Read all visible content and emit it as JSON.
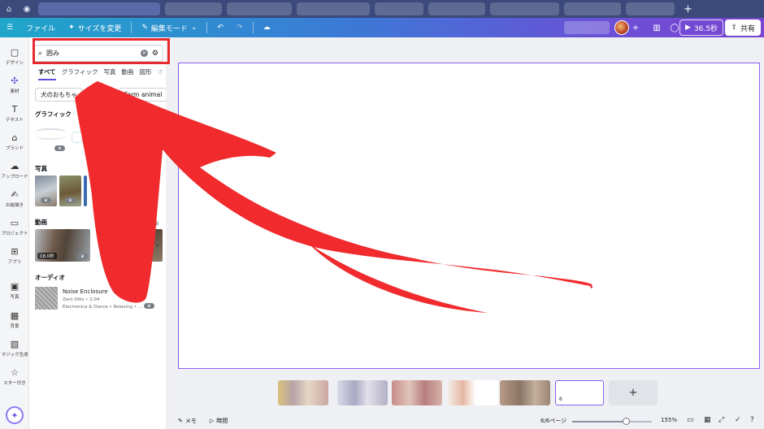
{
  "toolbar": {
    "file_label": "ファイル",
    "resize_label": "サイズを変更",
    "edit_mode_label": "編集モード",
    "play_label": "36.5秒",
    "share_label": "共有"
  },
  "rail": {
    "items": [
      {
        "label": "デザイン",
        "icon": "design-icon"
      },
      {
        "label": "素材",
        "icon": "elements-icon"
      },
      {
        "label": "テキスト",
        "icon": "text-icon"
      },
      {
        "label": "ブランド",
        "icon": "brand-icon"
      },
      {
        "label": "アップロード",
        "icon": "upload-icon"
      },
      {
        "label": "お絵描き",
        "icon": "draw-icon"
      },
      {
        "label": "プロジェクト",
        "icon": "folder-icon"
      },
      {
        "label": "アプリ",
        "icon": "apps-icon"
      },
      {
        "label": "写真",
        "icon": "photo-icon"
      },
      {
        "label": "背景",
        "icon": "background-icon"
      },
      {
        "label": "マジック生成",
        "icon": "magic-generate-icon"
      },
      {
        "label": "スター付き",
        "icon": "star-icon"
      }
    ]
  },
  "panel": {
    "search": {
      "value": "囲み"
    },
    "categories": [
      "すべて",
      "グラフィック",
      "写真",
      "動画",
      "図形",
      "オ"
    ],
    "chips": [
      "犬のおもちゃ",
      "Farm animal"
    ],
    "graphics_heading": "グラフィック",
    "photos_heading": "写真",
    "videos_heading": "動画",
    "videos_see_all": "て表示",
    "video_duration": "18.0秒",
    "audio_heading": "オーディオ",
    "audio": {
      "title": "Noise Enclosure",
      "artist_line": "Zero Otto • 2:04",
      "genre_line": "Electronica & Dance • Relaxing • ..."
    }
  },
  "filmstrip": {
    "current_page_number": "6"
  },
  "footer": {
    "notes_label": "メモ",
    "timer_label": "時間",
    "page_indicator": "6/6ページ",
    "zoom": "155%"
  },
  "colors": {
    "highlight_red": "#e8292e",
    "accent_purple": "#8b5cf6"
  }
}
